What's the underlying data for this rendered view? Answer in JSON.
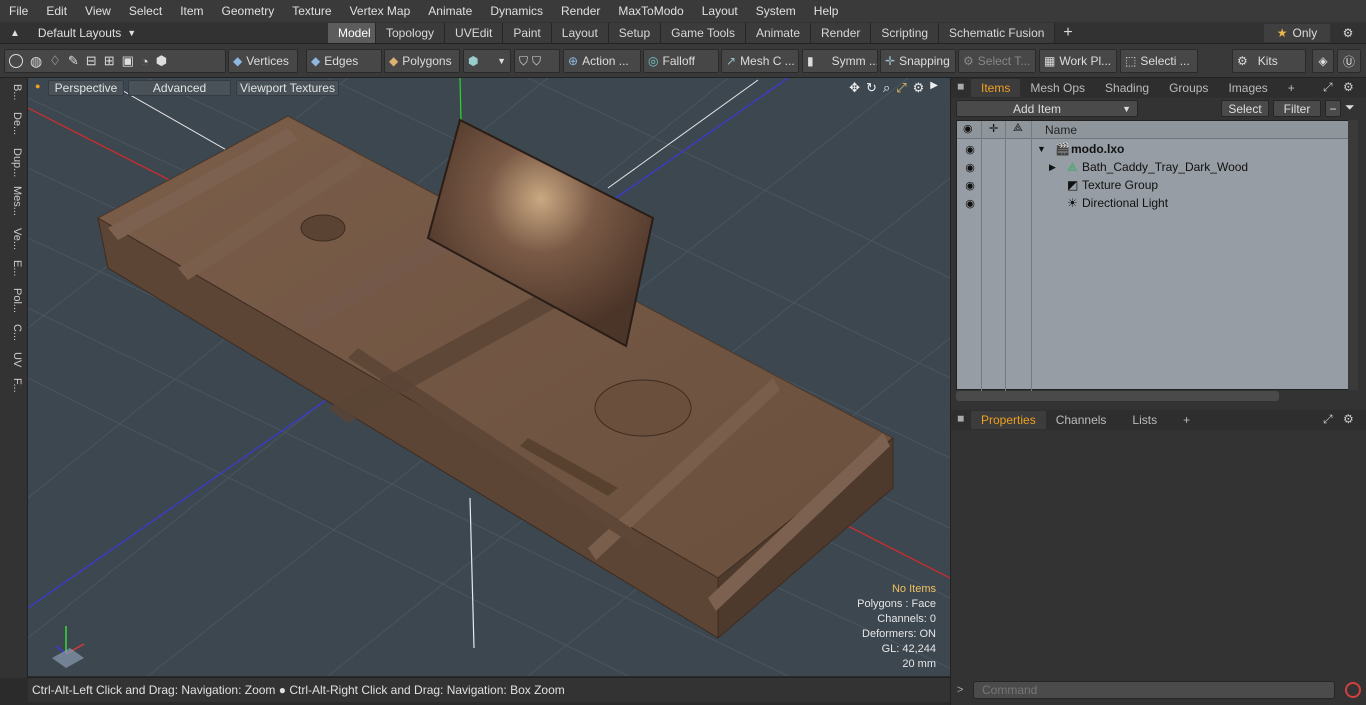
{
  "menu": [
    "File",
    "Edit",
    "View",
    "Select",
    "Item",
    "Geometry",
    "Texture",
    "Vertex Map",
    "Animate",
    "Dynamics",
    "Render",
    "MaxToModo",
    "Layout",
    "System",
    "Help"
  ],
  "layout": {
    "selector": "Default Layouts",
    "only_label": "Only"
  },
  "tabs": [
    "Model",
    "Topology",
    "UVEdit",
    "Paint",
    "Layout",
    "Setup",
    "Game Tools",
    "Animate",
    "Render",
    "Scripting",
    "Schematic Fusion"
  ],
  "active_tab": "Model",
  "toolbar": {
    "vertices": "Vertices",
    "edges": "Edges",
    "polygons": "Polygons",
    "action": "Action ...",
    "falloff": "Falloff",
    "mesh": "Mesh C ...",
    "symm": "Symm ...",
    "snapping": "Snapping",
    "select_t": "Select T...",
    "work_pl": "Work Pl...",
    "selecti": "Selecti ...",
    "kits": "Kits"
  },
  "left_tabs": [
    "B...",
    "De...",
    "Dup...",
    "Mes...",
    "Ve...",
    "E...",
    "Pol...",
    "C...",
    "UV",
    "F..."
  ],
  "viewport": {
    "perspective": "Perspective",
    "advanced": "Advanced",
    "viewport_textures": "Viewport Textures",
    "info": {
      "no_items": "No Items",
      "polygons": "Polygons : Face",
      "channels": "Channels: 0",
      "deformers": "Deformers: ON",
      "gl": "GL: 42,244",
      "scale": "20 mm"
    }
  },
  "status": "Ctrl-Alt-Left Click and Drag: Navigation: Zoom ● Ctrl-Alt-Right Click and Drag: Navigation: Box Zoom",
  "items_panel": {
    "tabs": [
      "Items",
      "Mesh Ops",
      "Shading",
      "Groups",
      "Images"
    ],
    "add_item": "Add Item",
    "select": "Select",
    "filter": "Filter",
    "col_name": "Name",
    "rows": [
      "modo.lxo",
      "Bath_Caddy_Tray_Dark_Wood",
      "Texture Group",
      "Directional Light"
    ]
  },
  "props_panel": {
    "tabs": [
      "Properties",
      "Channels",
      "Lists"
    ]
  },
  "command_placeholder": "Command",
  "colors": {
    "accent": "#f0a020",
    "viewport_bg": "#3d4750",
    "wood": "#6e5442"
  }
}
